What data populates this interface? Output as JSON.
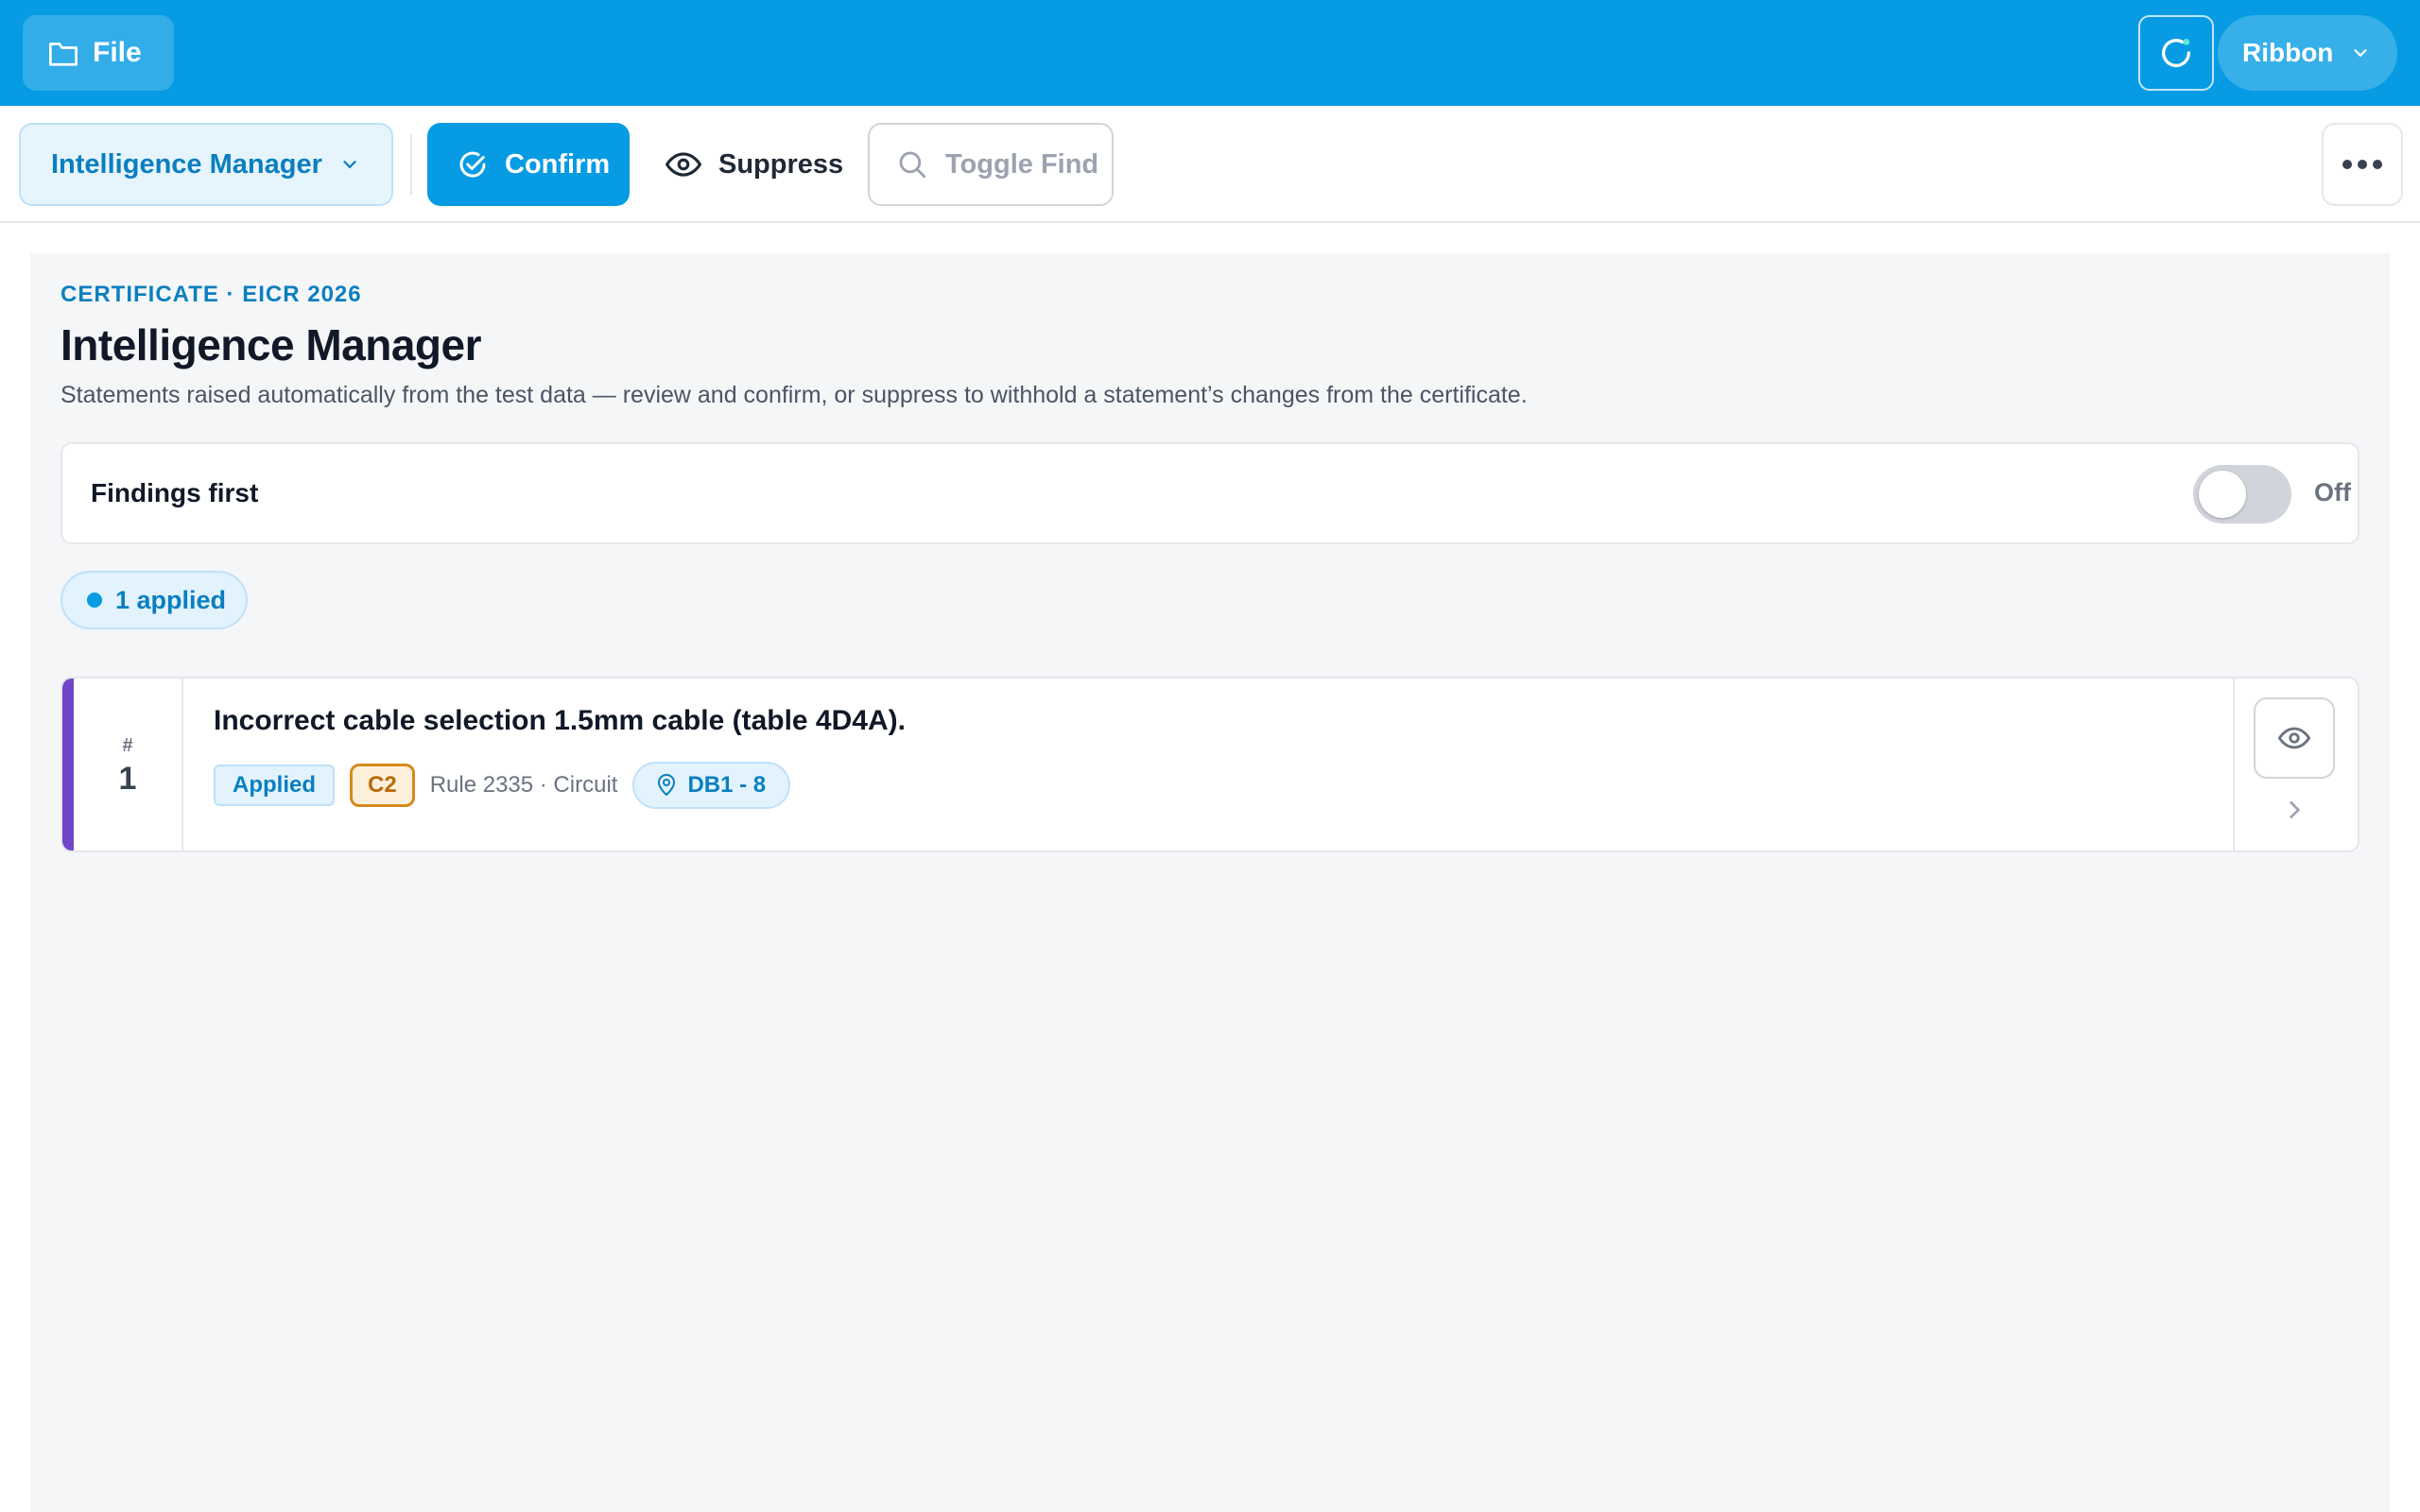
{
  "topbar": {
    "file_label": "File",
    "ribbon_label": "Ribbon"
  },
  "toolbar": {
    "view_label": "Intelligence Manager",
    "confirm_label": "Confirm",
    "suppress_label": "Suppress",
    "find_label": "Toggle Find"
  },
  "header": {
    "eyebrow": "CERTIFICATE · EICR 2026",
    "title": "Intelligence Manager",
    "description": "Statements raised automatically from the test data — review and confirm, or suppress to withhold a statement’s changes from the certificate."
  },
  "findings_toggle": {
    "label": "Findings first",
    "state": "Off"
  },
  "summary": {
    "applied_chip": "1 applied"
  },
  "statements": [
    {
      "hash": "#",
      "index": "1",
      "title": "Incorrect cable selection 1.5mm cable (table 4D4A).",
      "status": "Applied",
      "code": "C2",
      "rule": "Rule 2335 · Circuit",
      "location": "DB1 - 8"
    }
  ],
  "colors": {
    "brand": "#069be3",
    "accent_purple": "#7046c9",
    "c2_orange": "#d68a1c"
  }
}
